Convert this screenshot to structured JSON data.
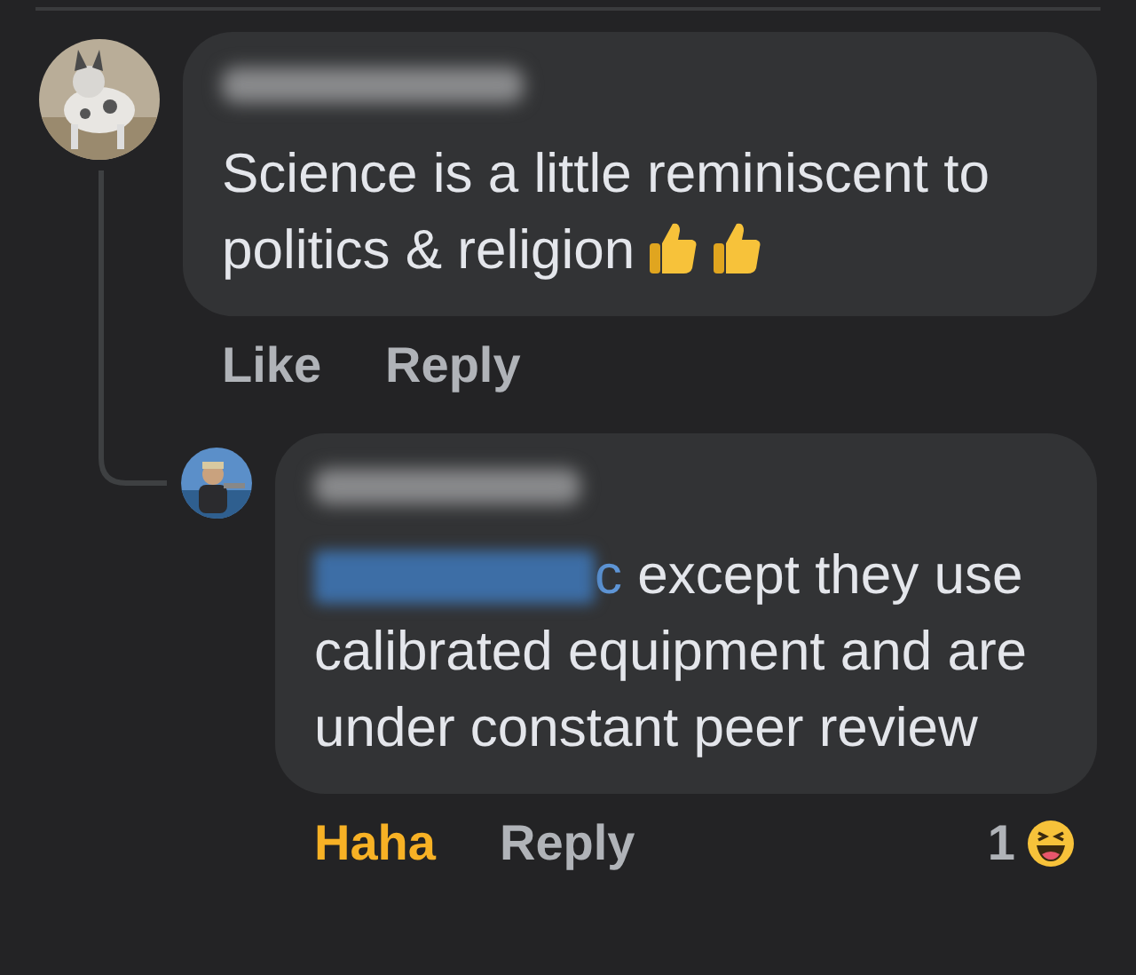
{
  "comments": [
    {
      "kind": "top",
      "text": "Science is a little reminiscent to politics & religion",
      "actions": [
        {
          "kind": "reaction",
          "label": "Like",
          "reacted": false
        },
        {
          "kind": "reply",
          "label": "Reply"
        }
      ]
    },
    {
      "kind": "reply",
      "mention": "c",
      "text": "except they use calibrated equipment and are under constant peer review",
      "actions": [
        {
          "kind": "reaction",
          "label": "Haha",
          "reacted": true
        },
        {
          "kind": "reply",
          "label": "Reply"
        }
      ],
      "reaction_count": "1"
    }
  ]
}
